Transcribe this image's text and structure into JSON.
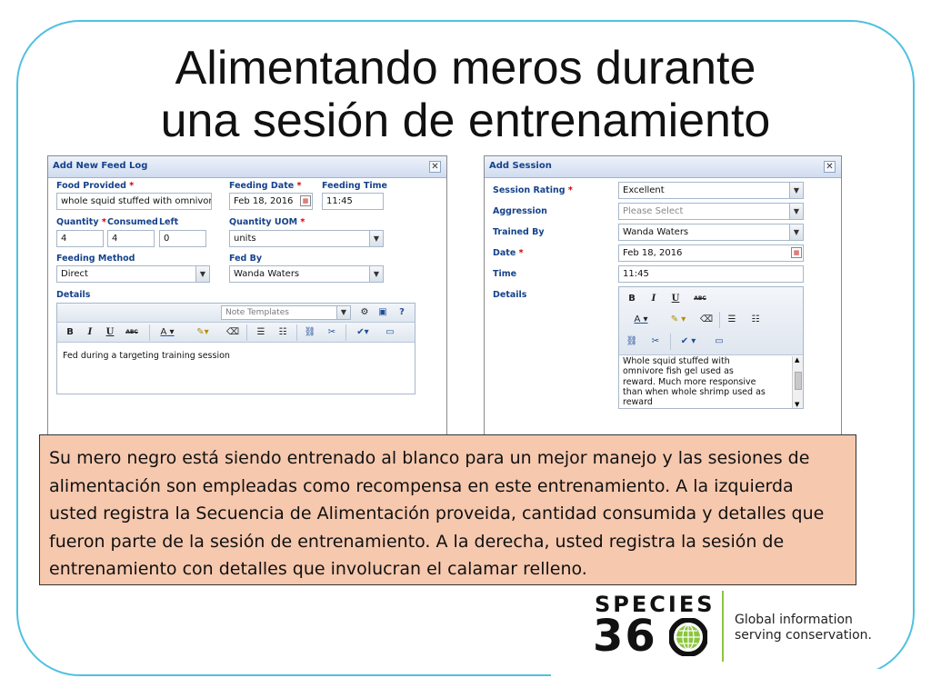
{
  "slide": {
    "title_line1": "Alimentando meros durante",
    "title_line2": "una sesión de entrenamiento"
  },
  "feed_log": {
    "title": "Add New Feed Log",
    "food_provided_label": "Food Provided",
    "food_provided_value": "whole squid stuffed with omnivore",
    "feeding_date_label": "Feeding Date",
    "feeding_date_value": "Feb 18, 2016",
    "feeding_time_label": "Feeding Time",
    "feeding_time_value": "11:45",
    "quantity_label": "Quantity",
    "quantity_value": "4",
    "consumed_label": "Consumed",
    "consumed_value": "4",
    "left_label": "Left",
    "left_value": "0",
    "quantity_uom_label": "Quantity UOM",
    "quantity_uom_value": "units",
    "feeding_method_label": "Feeding Method",
    "feeding_method_value": "Direct",
    "fed_by_label": "Fed By",
    "fed_by_value": "Wanda Waters",
    "details_label": "Details",
    "note_templates_placeholder": "Note Templates",
    "details_text": "Fed during a targeting training session"
  },
  "session": {
    "title": "Add Session",
    "rating_label": "Session Rating",
    "rating_value": "Excellent",
    "aggression_label": "Aggression",
    "aggression_placeholder": "Please Select",
    "trained_by_label": "Trained By",
    "trained_by_value": "Wanda Waters",
    "date_label": "Date",
    "date_value": "Feb 18, 2016",
    "time_label": "Time",
    "time_value": "11:45",
    "details_label": "Details",
    "details_text": "Whole squid stuffed with\nomnivore fish gel used as\nreward. Much more responsive\nthan when whole shrimp used as\nreward"
  },
  "toolbar": {
    "bold": "B",
    "italic": "I",
    "underline": "U",
    "spell": "ABC",
    "font_color": "A",
    "required_mark": "*"
  },
  "caption": {
    "text": "Su mero negro está siendo entrenado al blanco para un mejor manejo y las sesiones de alimentación son empleadas como recompensa en este entrenamiento. A la izquierda usted registra la Secuencia de Alimentación proveida, cantidad consumida y detalles que fueron parte de la sesión de entrenamiento. A la derecha, usted registra la sesión de entrenamiento con detalles que involucran el calamar relleno."
  },
  "logo": {
    "word": "SPECIES",
    "number": "36",
    "tagline_line1": "Global information",
    "tagline_line2": "serving conservation."
  },
  "colors": {
    "frame": "#4fc1e0",
    "caption_bg": "#f6c8ae",
    "label_blue": "#15428b",
    "divider_green": "#8cc63f"
  }
}
